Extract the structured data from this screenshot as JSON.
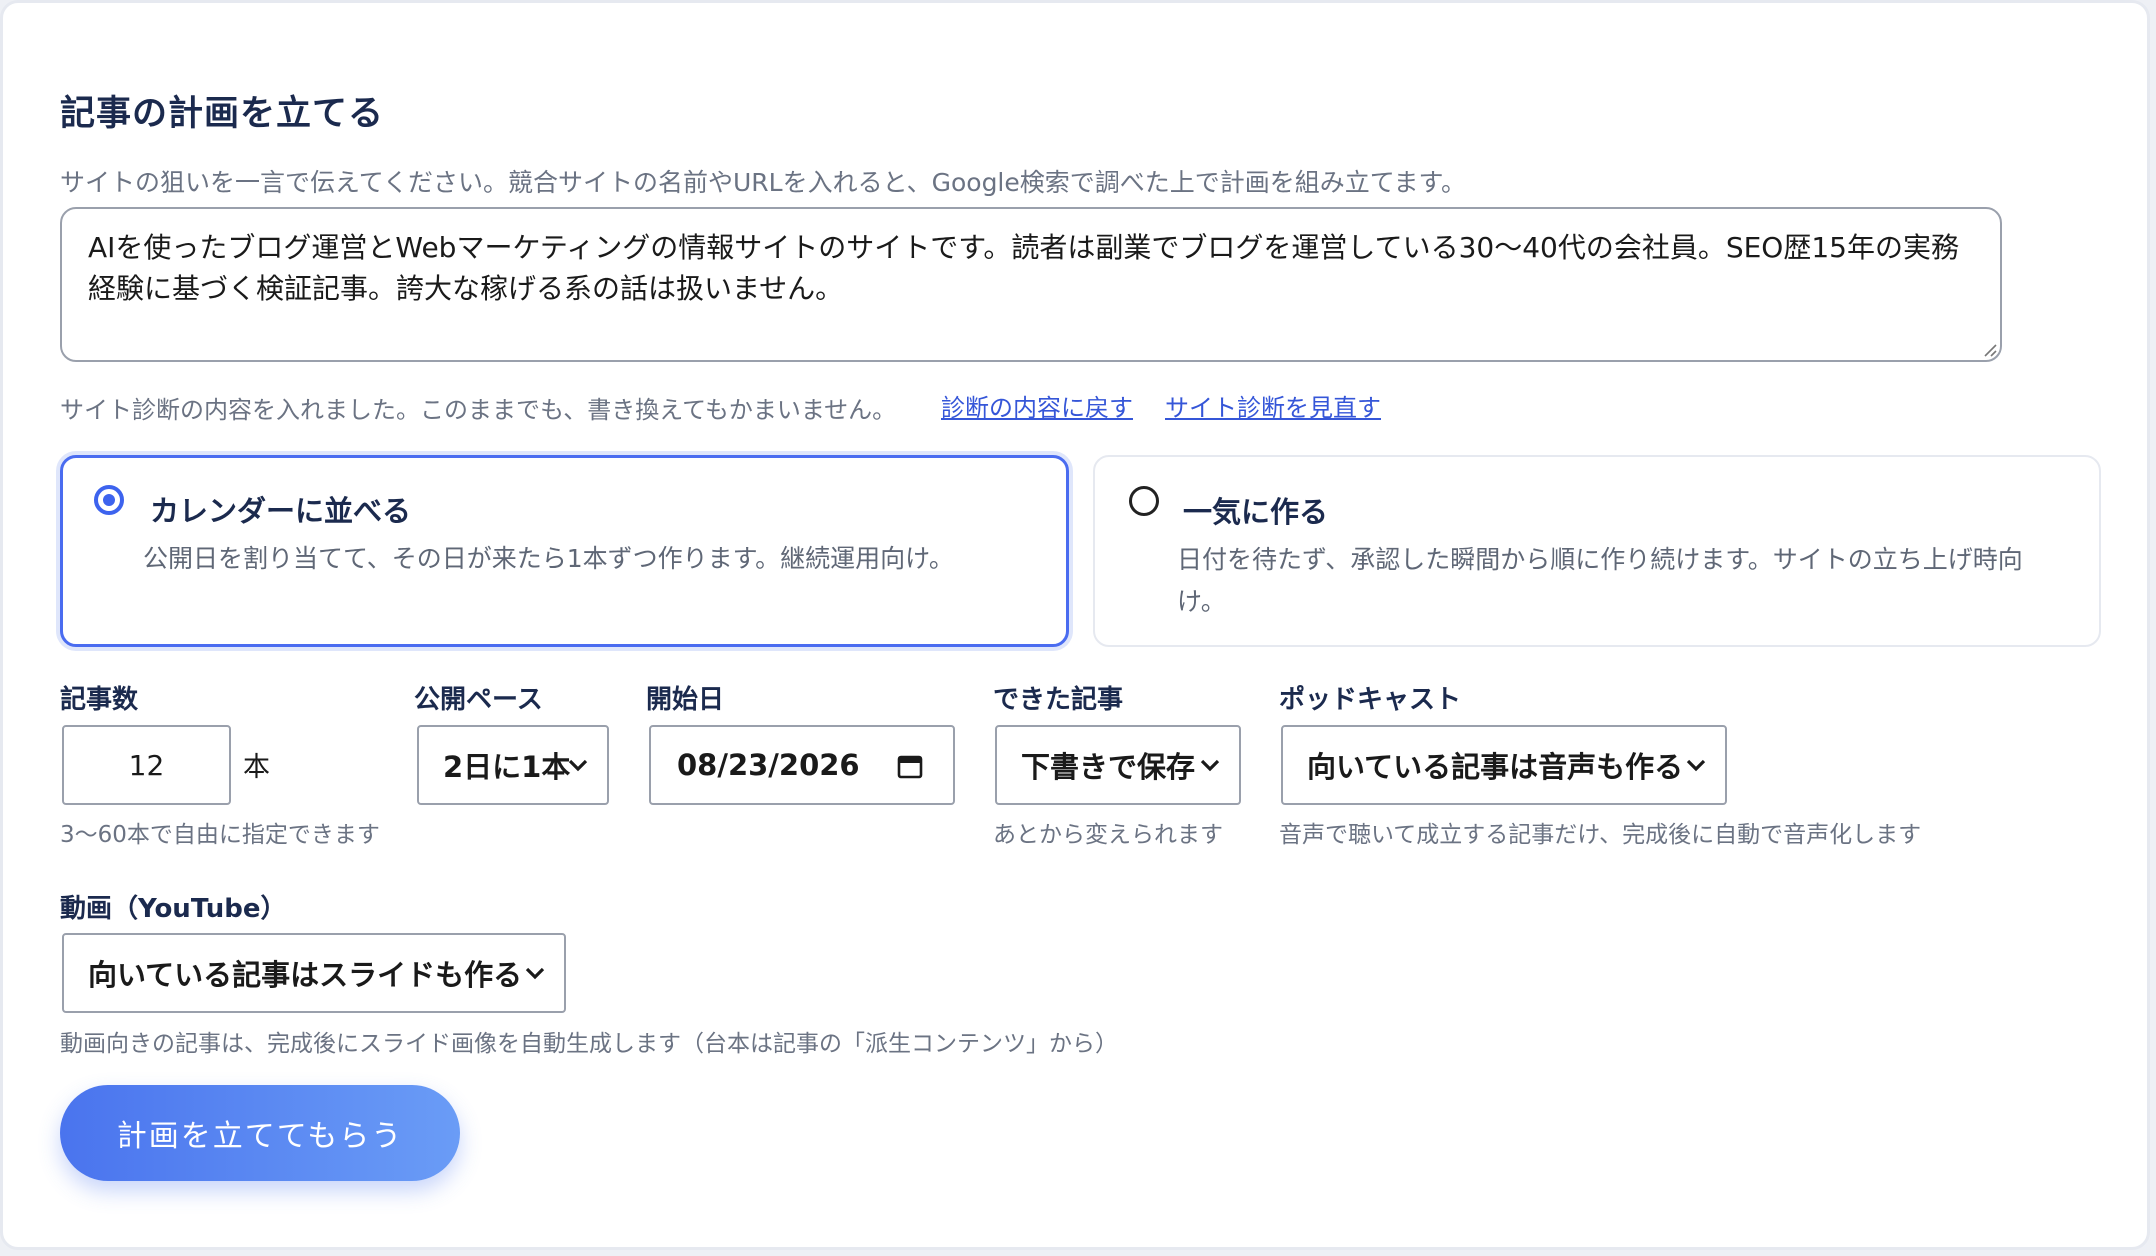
{
  "form": {
    "title": "記事の計画を立てる",
    "help_text": "サイトの狙いを一言で伝えてください。競合サイトの名前やURLを入れると、Google検索で調べた上で計画を組み立てます。",
    "site_description": "AIを使ったブログ運営とWebマーケティングの情報サイトのサイトです。読者は副業でブログを運営している30〜40代の会社員。SEO歴15年の実務経験に基づく検証記事。誇大な稼げる系の話は扱いません。",
    "prefill_note": "サイト診断の内容を入れました。このままでも、書き換えてもかまいません。",
    "restore_link": "診断の内容に戻す",
    "review_link": "サイト診断を見直す"
  },
  "modes": [
    {
      "title": "カレンダーに並べる",
      "description": "公開日を割り当てて、その日が来たら1本ずつ作ります。継続運用向け。",
      "selected": true
    },
    {
      "title": "一気に作る",
      "description": "日付を待たず、承認した瞬間から順に作り続けます。サイトの立ち上げ時向け。",
      "selected": false
    }
  ],
  "fields": {
    "count": {
      "label": "記事数",
      "value": "12",
      "unit": "本",
      "hint": "3〜60本で自由に指定できます"
    },
    "pace": {
      "label": "公開ペース",
      "value": "2日に1本"
    },
    "start_date": {
      "label": "開始日",
      "value": "08/23/2026"
    },
    "output": {
      "label": "できた記事",
      "value": "下書きで保存",
      "hint": "あとから変えられます"
    },
    "podcast": {
      "label": "ポッドキャスト",
      "value": "向いている記事は音声も作る",
      "hint": "音声で聴いて成立する記事だけ、完成後に自動で音声化します"
    },
    "video": {
      "label": "動画（YouTube）",
      "value": "向いている記事はスライドも作る",
      "hint": "動画向きの記事は、完成後にスライド画像を自動生成します（台本は記事の「派生コンテンツ」から）"
    }
  },
  "submit_label": "計画を立ててもらう",
  "colors": {
    "accent": "#3d63ee",
    "heading": "#1b2a4e",
    "muted": "#6b7383",
    "link": "#3556d8",
    "button_start": "#4a74ee",
    "button_end": "#6a9cf6"
  }
}
